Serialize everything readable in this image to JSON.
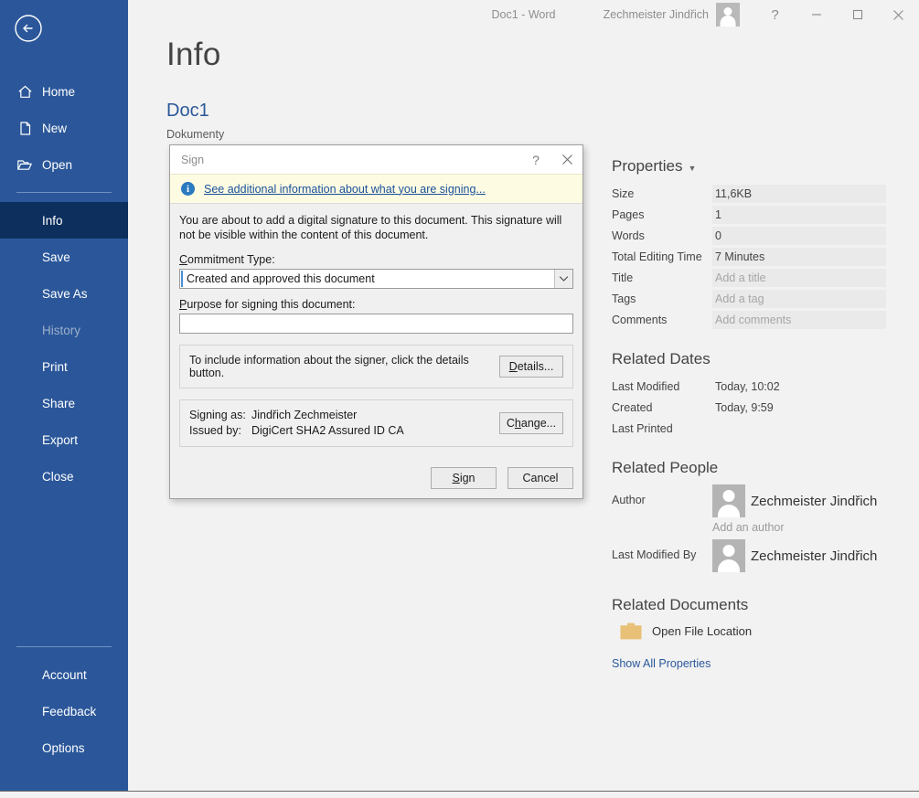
{
  "titlebar": {
    "document_title": "Doc1  -  Word",
    "account_name": "Zechmeister Jindřich",
    "help_label": "?",
    "minimize_label": "minimize",
    "maximize_label": "maximize",
    "close_label": "close"
  },
  "sidebar": {
    "back_label": "Back",
    "items": [
      {
        "label": "Home",
        "icon": "home-icon",
        "state": "normal"
      },
      {
        "label": "New",
        "icon": "new-document-icon",
        "state": "normal"
      },
      {
        "label": "Open",
        "icon": "open-folder-icon",
        "state": "normal"
      }
    ],
    "items2": [
      {
        "label": "Info",
        "state": "active"
      },
      {
        "label": "Save",
        "state": "normal"
      },
      {
        "label": "Save As",
        "state": "normal"
      },
      {
        "label": "History",
        "state": "disabled"
      },
      {
        "label": "Print",
        "state": "normal"
      },
      {
        "label": "Share",
        "state": "normal"
      },
      {
        "label": "Export",
        "state": "normal"
      },
      {
        "label": "Close",
        "state": "normal"
      }
    ],
    "items3": [
      {
        "label": "Account",
        "state": "normal"
      },
      {
        "label": "Feedback",
        "state": "normal"
      },
      {
        "label": "Options",
        "state": "normal"
      }
    ],
    "colors": {
      "background": "#2b579a",
      "active": "#0d2f5e",
      "text": "#ffffff",
      "disabled_text": "#9dafcb"
    }
  },
  "main": {
    "page_title": "Info",
    "doc_name": "Doc1",
    "doc_path": "Dokumenty"
  },
  "properties": {
    "heading": "Properties",
    "rows": [
      {
        "label": "Size",
        "value": "11,6KB",
        "empty": false
      },
      {
        "label": "Pages",
        "value": "1",
        "empty": false
      },
      {
        "label": "Words",
        "value": "0",
        "empty": false
      },
      {
        "label": "Total Editing Time",
        "value": "7 Minutes",
        "empty": false
      },
      {
        "label": "Title",
        "value": "Add a title",
        "empty": true
      },
      {
        "label": "Tags",
        "value": "Add a tag",
        "empty": true
      },
      {
        "label": "Comments",
        "value": "Add comments",
        "empty": true
      }
    ]
  },
  "related_dates": {
    "heading": "Related Dates",
    "rows": [
      {
        "label": "Last Modified",
        "value": "Today, 10:02"
      },
      {
        "label": "Created",
        "value": "Today, 9:59"
      },
      {
        "label": "Last Printed",
        "value": ""
      }
    ]
  },
  "related_people": {
    "heading": "Related People",
    "author_label": "Author",
    "author_name": "Zechmeister Jindřich",
    "add_author": "Add an author",
    "modified_by_label": "Last Modified By",
    "modified_by_name": "Zechmeister Jindřich"
  },
  "related_documents": {
    "heading": "Related Documents",
    "open_file_location": "Open File Location",
    "show_all_properties": "Show All Properties",
    "folder_color": "#e8c077"
  },
  "sign_dialog": {
    "title": "Sign",
    "help_label": "?",
    "close_label": "✕",
    "info_link": "See additional information about what you are signing...",
    "info_icon_glyph": "i",
    "description": "You are about to add a digital signature to this document. This signature will not be visible within the content of this document.",
    "commitment_label_accel": "C",
    "commitment_label_rest": "ommitment Type:",
    "commitment_value": "Created and approved this document",
    "purpose_label_accel": "P",
    "purpose_label_rest": "urpose for signing this document:",
    "purpose_value": "",
    "details_text": "To include information about the signer, click the details button.",
    "details_button_accel": "D",
    "details_button_rest": "etails...",
    "signing_as_key": "Signing as:",
    "signing_as_value": "Jindřich Zechmeister",
    "issued_by_key": "Issued by:",
    "issued_by_value": "DigiCert SHA2 Assured ID CA",
    "change_button_accel_pre": "C",
    "change_button_accel": "h",
    "change_button_rest": "ange...",
    "sign_button_accel": "S",
    "sign_button_rest": "ign",
    "cancel_button": "Cancel",
    "colors": {
      "infobar_bg": "#fdfce3",
      "link": "#1a4f99",
      "dialog_bg": "#f0f0f0"
    }
  }
}
